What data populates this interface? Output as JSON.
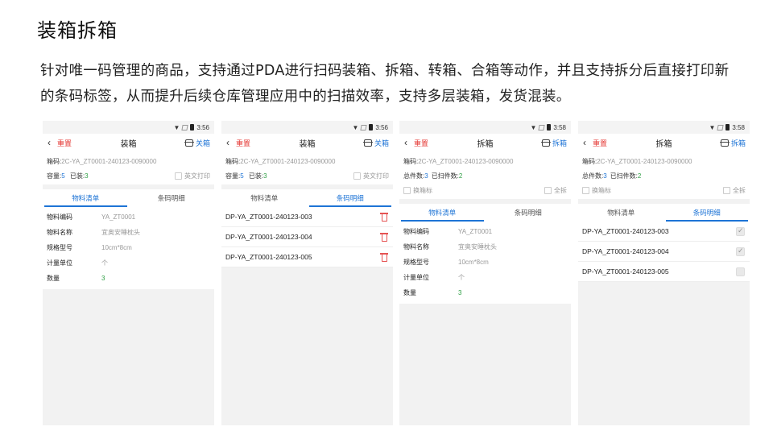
{
  "slide": {
    "title": "装箱拆箱",
    "description": "针对唯一码管理的商品，支持通过PDA进行扫码装箱、拆箱、转箱、合箱等动作，并且支持拆分后直接打印新的条码标签，从而提升后续仓库管理应用中的扫描效率，支持多层装箱，发货混装。"
  },
  "phones": [
    {
      "status_time": "3:56",
      "reset_label": "重置",
      "title": "装箱",
      "action_label": "关箱",
      "box_code_label": "箱码:",
      "box_code_value": "2C-YA_ZT0001-240123-0090000",
      "capacity_label": "容量:",
      "capacity_value": "5",
      "packed_label": "已装:",
      "packed_value": "3",
      "print_label": "英文打印",
      "tab_materials": "物料清单",
      "tab_barcodes": "条码明细",
      "fields": [
        {
          "label": "物料编码",
          "value": "YA_ZT0001"
        },
        {
          "label": "物料名称",
          "value": "宜奥安睡枕头"
        },
        {
          "label": "规格型号",
          "value": "10cm*8cm"
        },
        {
          "label": "计量单位",
          "value": "个"
        },
        {
          "label": "数量",
          "value": "3"
        }
      ]
    },
    {
      "status_time": "3:56",
      "reset_label": "重置",
      "title": "装箱",
      "action_label": "关箱",
      "box_code_label": "箱码:",
      "box_code_value": "2C-YA_ZT0001-240123-0090000",
      "capacity_label": "容量:",
      "capacity_value": "5",
      "packed_label": "已装:",
      "packed_value": "3",
      "print_label": "英文打印",
      "tab_materials": "物料清单",
      "tab_barcodes": "条码明细",
      "barcodes": [
        "DP-YA_ZT0001-240123-003",
        "DP-YA_ZT0001-240123-004",
        "DP-YA_ZT0001-240123-005"
      ]
    },
    {
      "status_time": "3:58",
      "reset_label": "重置",
      "title": "拆箱",
      "action_label": "拆箱",
      "box_code_label": "箱码:",
      "box_code_value": "2C-YA_ZT0001-240123-0090000",
      "total_label": "总件数:",
      "total_value": "3",
      "scanned_label": "已扫件数:",
      "scanned_value": "2",
      "relabel_label": "换箱标",
      "select_all_label": "全拆",
      "tab_materials": "物料清单",
      "tab_barcodes": "条码明细",
      "fields": [
        {
          "label": "物料编码",
          "value": "YA_ZT0001"
        },
        {
          "label": "物料名称",
          "value": "宜奥安睡枕头"
        },
        {
          "label": "规格型号",
          "value": "10cm*8cm"
        },
        {
          "label": "计量单位",
          "value": "个"
        },
        {
          "label": "数量",
          "value": "3"
        }
      ]
    },
    {
      "status_time": "3:58",
      "reset_label": "重置",
      "title": "拆箱",
      "action_label": "拆箱",
      "box_code_label": "箱码:",
      "box_code_value": "2C-YA_ZT0001-240123-0090000",
      "total_label": "总件数:",
      "total_value": "3",
      "scanned_label": "已扫件数:",
      "scanned_value": "2",
      "relabel_label": "换箱标",
      "select_all_label": "全拆",
      "tab_materials": "物料清单",
      "tab_barcodes": "条码明细",
      "barcodes": [
        "DP-YA_ZT0001-240123-003",
        "DP-YA_ZT0001-240123-004",
        "DP-YA_ZT0001-240123-005"
      ]
    }
  ],
  "colors": {
    "accent": "#1e74d6",
    "danger": "#e53935",
    "success": "#2e9e44"
  }
}
